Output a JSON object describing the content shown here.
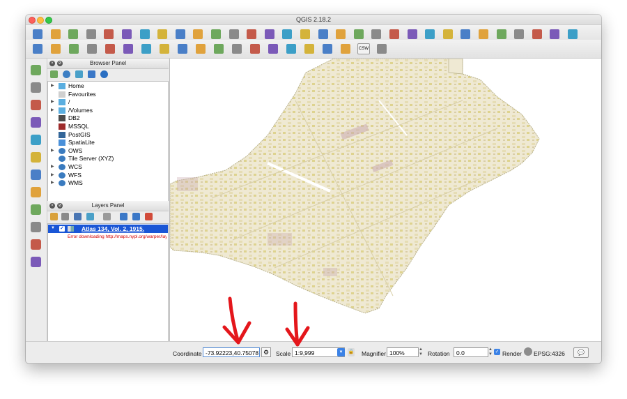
{
  "window": {
    "title": "QGIS 2.18.2"
  },
  "toolbar_top": {
    "icons": [
      "new-project-icon",
      "open-project-icon",
      "save-project-icon",
      "save-as-icon",
      "print-composer-icon",
      "composer-manager-icon",
      "pan-icon",
      "pan-to-selection-icon",
      "zoom-in-icon",
      "zoom-out-icon",
      "zoom-native-icon",
      "zoom-full-icon",
      "zoom-selection-icon",
      "zoom-layer-icon",
      "zoom-last-icon",
      "zoom-next-icon",
      "bookmark-icon",
      "show-bookmarks-icon",
      "refresh-icon",
      "identify-icon",
      "measure-icon",
      "select-icon",
      "deselect-icon",
      "attribute-table-icon",
      "field-calculator-icon",
      "statistics-icon",
      "sum-icon",
      "ruler-icon",
      "annotation-icon",
      "text-annotation-icon",
      "help-icon"
    ]
  },
  "toolbar_edit": {
    "icons": [
      "current-edits-icon",
      "toggle-editing-icon",
      "save-edits-icon",
      "add-feature-icon",
      "add-polygon-icon",
      "node-tool-icon",
      "delete-selected-icon",
      "cut-icon",
      "copy-icon",
      "paste-icon",
      "label-icon",
      "diagram-icon",
      "label-pin-icon",
      "label-highlight-icon",
      "label-show-hide-icon",
      "label-move-icon",
      "label-rotate-icon",
      "label-change-icon",
      "csw-icon",
      "python-icon"
    ],
    "csw_label": "CSW"
  },
  "left_toolbar": {
    "icons": [
      "add-vector-layer-icon",
      "add-raster-layer-icon",
      "add-delimited-text-icon",
      "add-spatialite-icon",
      "add-postgis-icon",
      "add-wms-icon",
      "add-wcs-icon",
      "add-wfs-icon",
      "add-virtual-layer-icon",
      "new-shapefile-icon",
      "new-spatialite-icon",
      "add-oracle-icon"
    ]
  },
  "browser_panel": {
    "title": "Browser Panel",
    "items": [
      {
        "label": "Home",
        "icon": "folder-icon",
        "expandable": true
      },
      {
        "label": "Favourites",
        "icon": "star-icon",
        "expandable": false
      },
      {
        "label": "/",
        "icon": "folder-icon",
        "expandable": true
      },
      {
        "label": "/Volumes",
        "icon": "folder-icon",
        "expandable": true
      },
      {
        "label": "DB2",
        "icon": "db2-icon",
        "expandable": false
      },
      {
        "label": "MSSQL",
        "icon": "mssql-icon",
        "expandable": false
      },
      {
        "label": "PostGIS",
        "icon": "postgis-icon",
        "expandable": false
      },
      {
        "label": "SpatiaLite",
        "icon": "spatialite-icon",
        "expandable": false
      },
      {
        "label": "OWS",
        "icon": "globe-icon",
        "expandable": true
      },
      {
        "label": "Tile Server (XYZ)",
        "icon": "globe-icon",
        "expandable": false
      },
      {
        "label": "WCS",
        "icon": "globe-icon",
        "expandable": true
      },
      {
        "label": "WFS",
        "icon": "globe-icon",
        "expandable": true
      },
      {
        "label": "WMS",
        "icon": "globe-icon",
        "expandable": true
      }
    ]
  },
  "layers_panel": {
    "title": "Layers Panel",
    "layer": {
      "name": "Atlas 134, Vol. 2, 1915.",
      "checked": true
    },
    "error": "Error downloading http://maps.nypl.org/warper/laye"
  },
  "statusbar": {
    "coordinate_label": "Coordinate",
    "coordinate_value": "-73.92223,40.75078",
    "scale_label": "Scale",
    "scale_value": "1:9,999",
    "magnifier_label": "Magnifier",
    "magnifier_value": "100%",
    "rotation_label": "Rotation",
    "rotation_value": "0.0",
    "render_label": "Render",
    "render_checked": true,
    "crs_label": "EPSG:4326"
  },
  "colors": {
    "selection": "#1a56d6",
    "error": "#d40000",
    "annotation_arrow": "#e4161b",
    "map_base": "#f0ecd6"
  }
}
